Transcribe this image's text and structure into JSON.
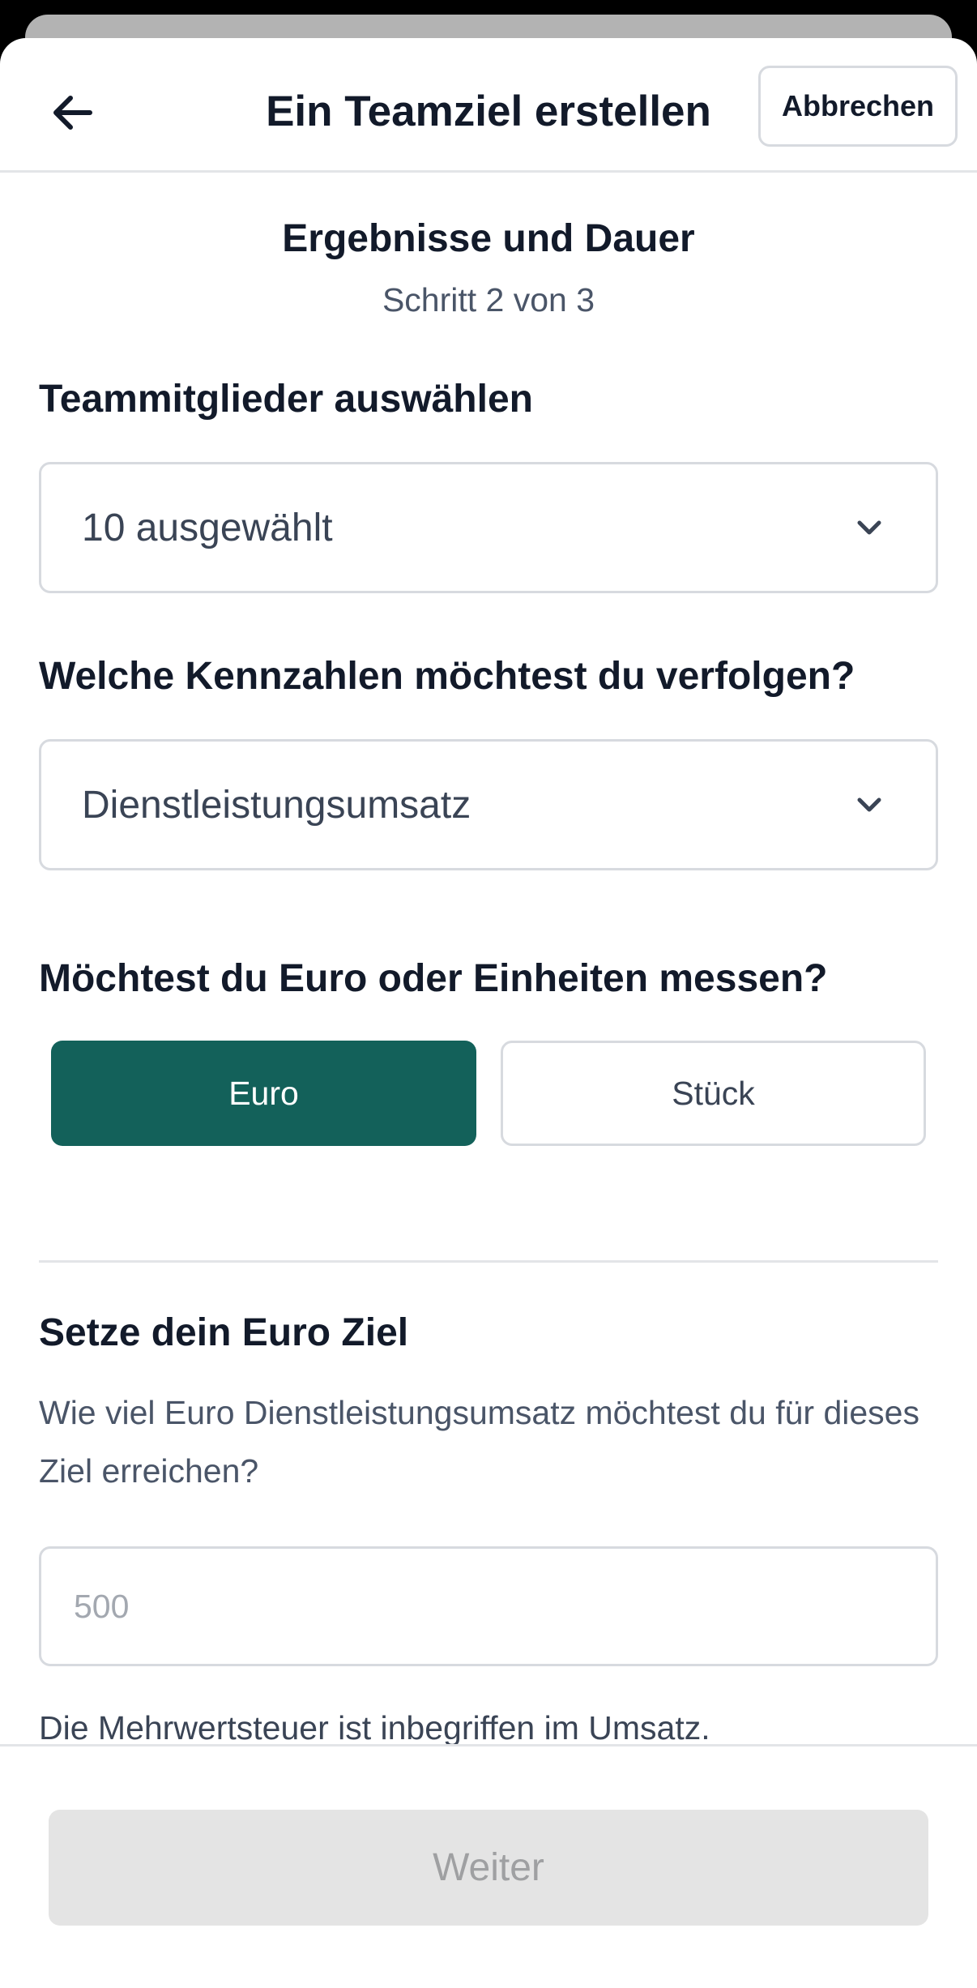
{
  "header": {
    "title": "Ein Teamziel erstellen",
    "cancel_label": "Abbrechen",
    "back_icon": "arrow-left-icon"
  },
  "step": {
    "title": "Ergebnisse und Dauer",
    "progress": "Schritt 2 von 3"
  },
  "team_members": {
    "label": "Teammitglieder auswählen",
    "value": "10 ausgewählt"
  },
  "metrics": {
    "label": "Welche Kennzahlen möchtest du verfolgen?",
    "value": "Dienstleistungsumsatz"
  },
  "measure": {
    "label": "Möchtest du Euro oder Einheiten messen?",
    "options": [
      "Euro",
      "Stück"
    ],
    "selected": "Euro",
    "accent_color": "#13615a"
  },
  "goal": {
    "title": "Setze dein Euro Ziel",
    "description": "Wie viel Euro Dienstleistungsumsatz möchtest du für dieses Ziel erreichen?",
    "placeholder": "500",
    "note": "Die Mehrwertsteuer ist inbegriffen im Umsatz."
  },
  "footer": {
    "next_label": "Weiter"
  }
}
